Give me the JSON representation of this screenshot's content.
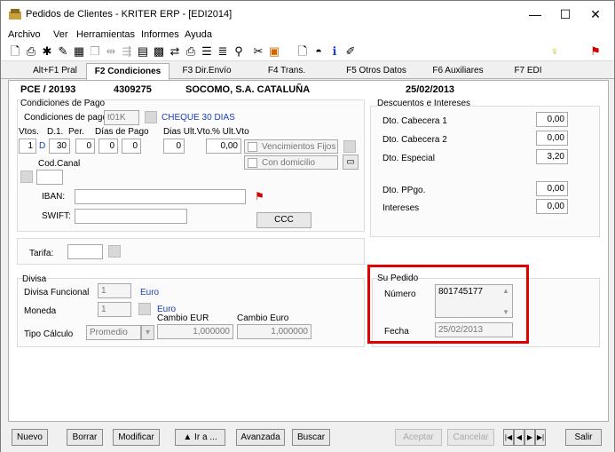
{
  "window": {
    "title": "Pedidos de Clientes - KRITER ERP - [EDI2014]",
    "minimize": "—",
    "maximize": "☐",
    "close": "✕"
  },
  "menu": [
    "Archivo",
    "Ver",
    "Herramientas",
    "Informes",
    "Ayuda"
  ],
  "tabs": [
    "Alt+F1 Pral",
    "F2 Condiciones",
    "F3 Dir.Envío",
    "F4 Trans.",
    "F5 Otros Datos",
    "F6 Auxiliares",
    "F7 EDI"
  ],
  "header": {
    "order": "PCE / 20193",
    "client_code": "4309275",
    "client_name": "SOCOMO, S.A. CATALUÑA",
    "date": "25/02/2013"
  },
  "condiciones": {
    "group_title": "Condiciones de Pago",
    "label": "Condiciones de pago",
    "code": "t01K",
    "description": "CHEQUE 30 DIAS",
    "col_vtos": "Vtos.",
    "col_d1": "D.1.",
    "col_per": "Per.",
    "col_dias": "Días de Pago",
    "col_ultvto": "Dias Ult.Vto.",
    "col_pctvto": "% Ult.Vto",
    "vtos": "1",
    "d1": "D",
    "per": "30",
    "dias": [
      "0",
      "0",
      "0"
    ],
    "ultvto": "0",
    "pctvto": "0,00",
    "venc_fijos": "Vencimientos Fijos",
    "con_domicilio": "Con domicilio",
    "cod_canal": "Cod.Canal",
    "iban": "IBAN:",
    "swift": "SWIFT:",
    "ccc": "CCC"
  },
  "descuentos": {
    "group_title": "Descuentos e Intereses",
    "rows": [
      {
        "label": "Dto. Cabecera 1",
        "value": "0,00"
      },
      {
        "label": "Dto. Cabecera 2",
        "value": "0,00"
      },
      {
        "label": "Dto. Especial",
        "value": "3,20"
      },
      {
        "label": "Dto. PPgo.",
        "value": "0,00"
      },
      {
        "label": "Intereses",
        "value": "0,00"
      }
    ]
  },
  "tarifa": {
    "label": "Tarifa:"
  },
  "divisa": {
    "group_title": "Divisa",
    "funcional_label": "Divisa Funcional",
    "funcional_value": "1",
    "funcional_name": "Euro",
    "moneda_label": "Moneda",
    "moneda_value": "1",
    "moneda_name": "Euro",
    "cambio_eur_label": "Cambio EUR",
    "cambio_euro_label": "Cambio Euro",
    "tipo_label": "Tipo Cálculo",
    "tipo_value": "Promedio",
    "cambio_eur": "1,000000",
    "cambio_euro": "1,000000"
  },
  "su_pedido": {
    "group_title": "Su Pedido",
    "numero_label": "Número",
    "numero": "801745177",
    "fecha_label": "Fecha",
    "fecha": "25/02/2013"
  },
  "buttons": [
    "Nuevo",
    "Borrar",
    "Modificar",
    "▲ Ir a ...",
    "Avanzada",
    "Buscar",
    "Aceptar",
    "Cancelar",
    "Salir"
  ]
}
